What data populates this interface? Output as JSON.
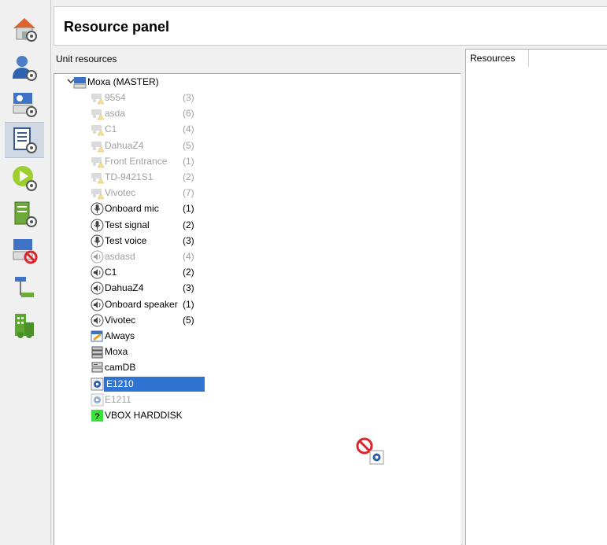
{
  "header": {
    "title": "Resource panel"
  },
  "unit_panel": {
    "title": "Unit resources"
  },
  "resources_panel": {
    "tab_label": "Resources"
  },
  "sidebar": {
    "items": [
      {
        "name": "home-settings-icon",
        "active": false
      },
      {
        "name": "user-settings-icon",
        "active": false
      },
      {
        "name": "unit-settings-icon",
        "active": false
      },
      {
        "name": "resource-panel-icon",
        "active": true
      },
      {
        "name": "play-settings-icon",
        "active": false
      },
      {
        "name": "server-settings-icon",
        "active": false
      },
      {
        "name": "unit-blocked-icon",
        "active": false
      },
      {
        "name": "network-icon",
        "active": false
      },
      {
        "name": "building-icon",
        "active": false
      }
    ]
  },
  "tree": {
    "root": {
      "label": "Moxa (MASTER)",
      "expanded": true
    },
    "items": [
      {
        "label": "9554",
        "count": "(3)",
        "type": "camera-warning",
        "disabled": true
      },
      {
        "label": "asda",
        "count": "(6)",
        "type": "camera-warning",
        "disabled": true
      },
      {
        "label": "C1",
        "count": "(4)",
        "type": "camera-warning",
        "disabled": true
      },
      {
        "label": "DahuaZ4",
        "count": "(5)",
        "type": "camera-warning",
        "disabled": true
      },
      {
        "label": "Front Entrance",
        "count": "(1)",
        "type": "camera-warning",
        "disabled": true
      },
      {
        "label": "TD-9421S1",
        "count": "(2)",
        "type": "camera-warning",
        "disabled": true
      },
      {
        "label": "Vivotec",
        "count": "(7)",
        "type": "camera-warning",
        "disabled": true
      },
      {
        "label": "Onboard mic",
        "count": "(1)",
        "type": "microphone",
        "disabled": false
      },
      {
        "label": "Test signal",
        "count": "(2)",
        "type": "microphone",
        "disabled": false
      },
      {
        "label": "Test voice",
        "count": "(3)",
        "type": "microphone",
        "disabled": false
      },
      {
        "label": "asdasd",
        "count": "(4)",
        "type": "speaker",
        "disabled": true
      },
      {
        "label": "C1",
        "count": "(2)",
        "type": "speaker",
        "disabled": false
      },
      {
        "label": "DahuaZ4",
        "count": "(3)",
        "type": "speaker",
        "disabled": false
      },
      {
        "label": "Onboard speaker",
        "count": "(1)",
        "type": "speaker",
        "disabled": false
      },
      {
        "label": "Vivotec",
        "count": "(5)",
        "type": "speaker",
        "disabled": false
      },
      {
        "label": "Always",
        "count": "",
        "type": "schedule",
        "disabled": false
      },
      {
        "label": "Moxa",
        "count": "",
        "type": "server",
        "disabled": false
      },
      {
        "label": "camDB",
        "count": "",
        "type": "database",
        "disabled": false
      },
      {
        "label": "E1210",
        "count": "",
        "type": "io-module",
        "disabled": false,
        "selected": true
      },
      {
        "label": "E1211",
        "count": "",
        "type": "io-module",
        "disabled": true
      },
      {
        "label": "VBOX HARDDISK",
        "count": "",
        "type": "disk",
        "disabled": false
      }
    ]
  },
  "drag_cursor": {
    "name": "no-drop-icon"
  },
  "colors": {
    "selection": "#2f74d2",
    "disabled_text": "#a0a0a0",
    "disk_green": "#39e13a"
  }
}
